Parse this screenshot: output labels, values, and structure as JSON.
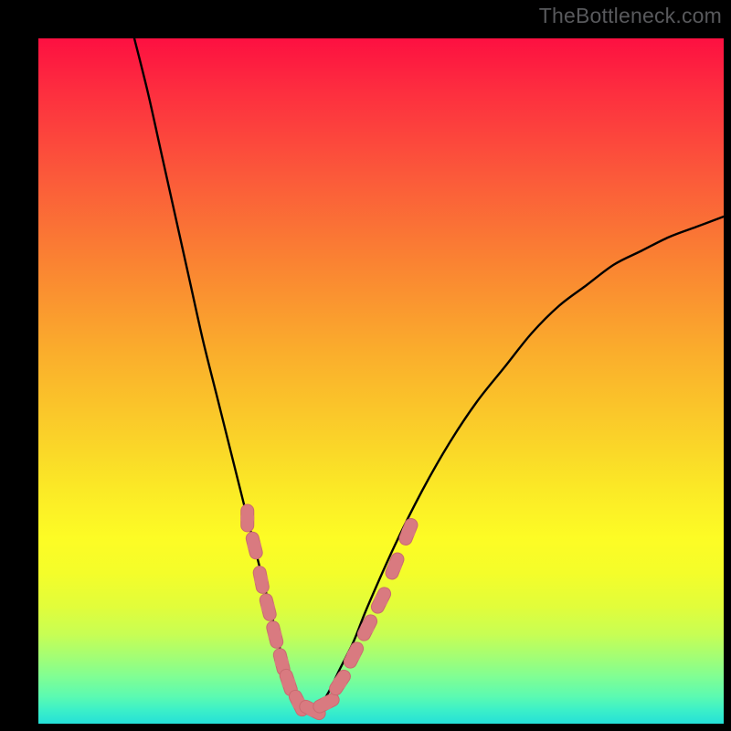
{
  "watermark": "TheBottleneck.com",
  "colors": {
    "curve": "#000000",
    "marker_fill": "#d97a80",
    "marker_stroke": "#c96a70"
  },
  "chart_data": {
    "type": "line",
    "title": "",
    "xlabel": "",
    "ylabel": "",
    "xlim": [
      0,
      100
    ],
    "ylim": [
      0,
      100
    ],
    "series": [
      {
        "name": "bottleneck-curve",
        "x": [
          14,
          16,
          18,
          20,
          22,
          24,
          26,
          28,
          30,
          32,
          34,
          35,
          36,
          37,
          38,
          40,
          42,
          44,
          46,
          48,
          52,
          56,
          60,
          64,
          68,
          72,
          76,
          80,
          84,
          88,
          92,
          96,
          100
        ],
        "values": [
          100,
          92,
          83,
          74,
          65,
          56,
          48,
          40,
          32,
          24,
          16,
          12,
          8,
          5,
          3,
          2,
          4,
          8,
          12,
          17,
          26,
          34,
          41,
          47,
          52,
          57,
          61,
          64,
          67,
          69,
          71,
          72.5,
          74
        ]
      }
    ],
    "markers": {
      "name": "highlight-cluster",
      "points": [
        {
          "x": 30.5,
          "y": 30
        },
        {
          "x": 31.5,
          "y": 26
        },
        {
          "x": 32.5,
          "y": 21
        },
        {
          "x": 33.5,
          "y": 17
        },
        {
          "x": 34.5,
          "y": 13
        },
        {
          "x": 35.5,
          "y": 9
        },
        {
          "x": 36.5,
          "y": 6
        },
        {
          "x": 38,
          "y": 3
        },
        {
          "x": 40,
          "y": 2
        },
        {
          "x": 42,
          "y": 3
        },
        {
          "x": 44,
          "y": 6
        },
        {
          "x": 46,
          "y": 10
        },
        {
          "x": 48,
          "y": 14
        },
        {
          "x": 50,
          "y": 18
        },
        {
          "x": 52,
          "y": 23
        },
        {
          "x": 54,
          "y": 28
        }
      ]
    }
  }
}
